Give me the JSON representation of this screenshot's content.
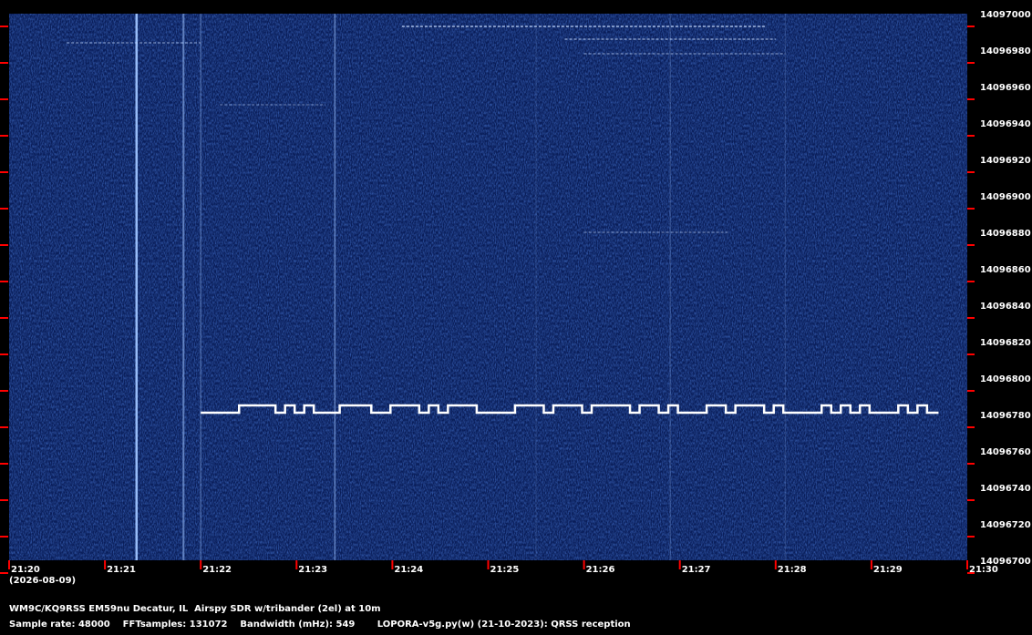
{
  "chart_data": {
    "type": "heatmap",
    "title": "",
    "xlabel": "",
    "ylabel": "",
    "x_ticks": [
      "21:20",
      "21:21",
      "21:22",
      "21:23",
      "21:24",
      "21:25",
      "21:26",
      "21:27",
      "21:28",
      "21:29",
      "21:30"
    ],
    "x_range_minutes": [
      0,
      10
    ],
    "y_ticks": [
      14097000,
      14096980,
      14096960,
      14096940,
      14096920,
      14096900,
      14096880,
      14096860,
      14096840,
      14096820,
      14096800,
      14096780,
      14096760,
      14096740,
      14096720,
      14096700
    ],
    "ylim": [
      14096700,
      14097000
    ],
    "date": "(2026-08-09)",
    "background_color": "#0a1e5a",
    "signal_color": "#ffffff",
    "tick_color": "#ff0000",
    "signal_trace": {
      "description_values": "QRSS FSK signal, frequency alternates between base and mark levels",
      "base_hz": 14096781,
      "mark_hz": 14096785,
      "start_min": 2.0,
      "end_min": 9.7,
      "mark_intervals_min": [
        [
          2.4,
          2.78
        ],
        [
          2.88,
          2.98
        ],
        [
          3.08,
          3.18
        ],
        [
          3.45,
          3.78
        ],
        [
          3.98,
          4.28
        ],
        [
          4.38,
          4.48
        ],
        [
          4.58,
          4.88
        ],
        [
          5.28,
          5.58
        ],
        [
          5.68,
          5.98
        ],
        [
          6.08,
          6.48
        ],
        [
          6.58,
          6.78
        ],
        [
          6.88,
          6.98
        ],
        [
          7.28,
          7.48
        ],
        [
          7.58,
          7.88
        ],
        [
          7.98,
          8.08
        ],
        [
          8.48,
          8.58
        ],
        [
          8.68,
          8.78
        ],
        [
          8.88,
          8.98
        ],
        [
          9.28,
          9.38
        ],
        [
          9.48,
          9.58
        ]
      ]
    }
  },
  "footer": {
    "station": "WM9C/KQ9RSS EM59nu Decatur, IL  Airspy SDR w/tribander (2el) at 10m",
    "params": "Sample rate: 48000    FFTsamples: 131072    Bandwidth (mHz): 549       LOPORA-v5g.py(w) (21-10-2023): QRSS reception"
  }
}
